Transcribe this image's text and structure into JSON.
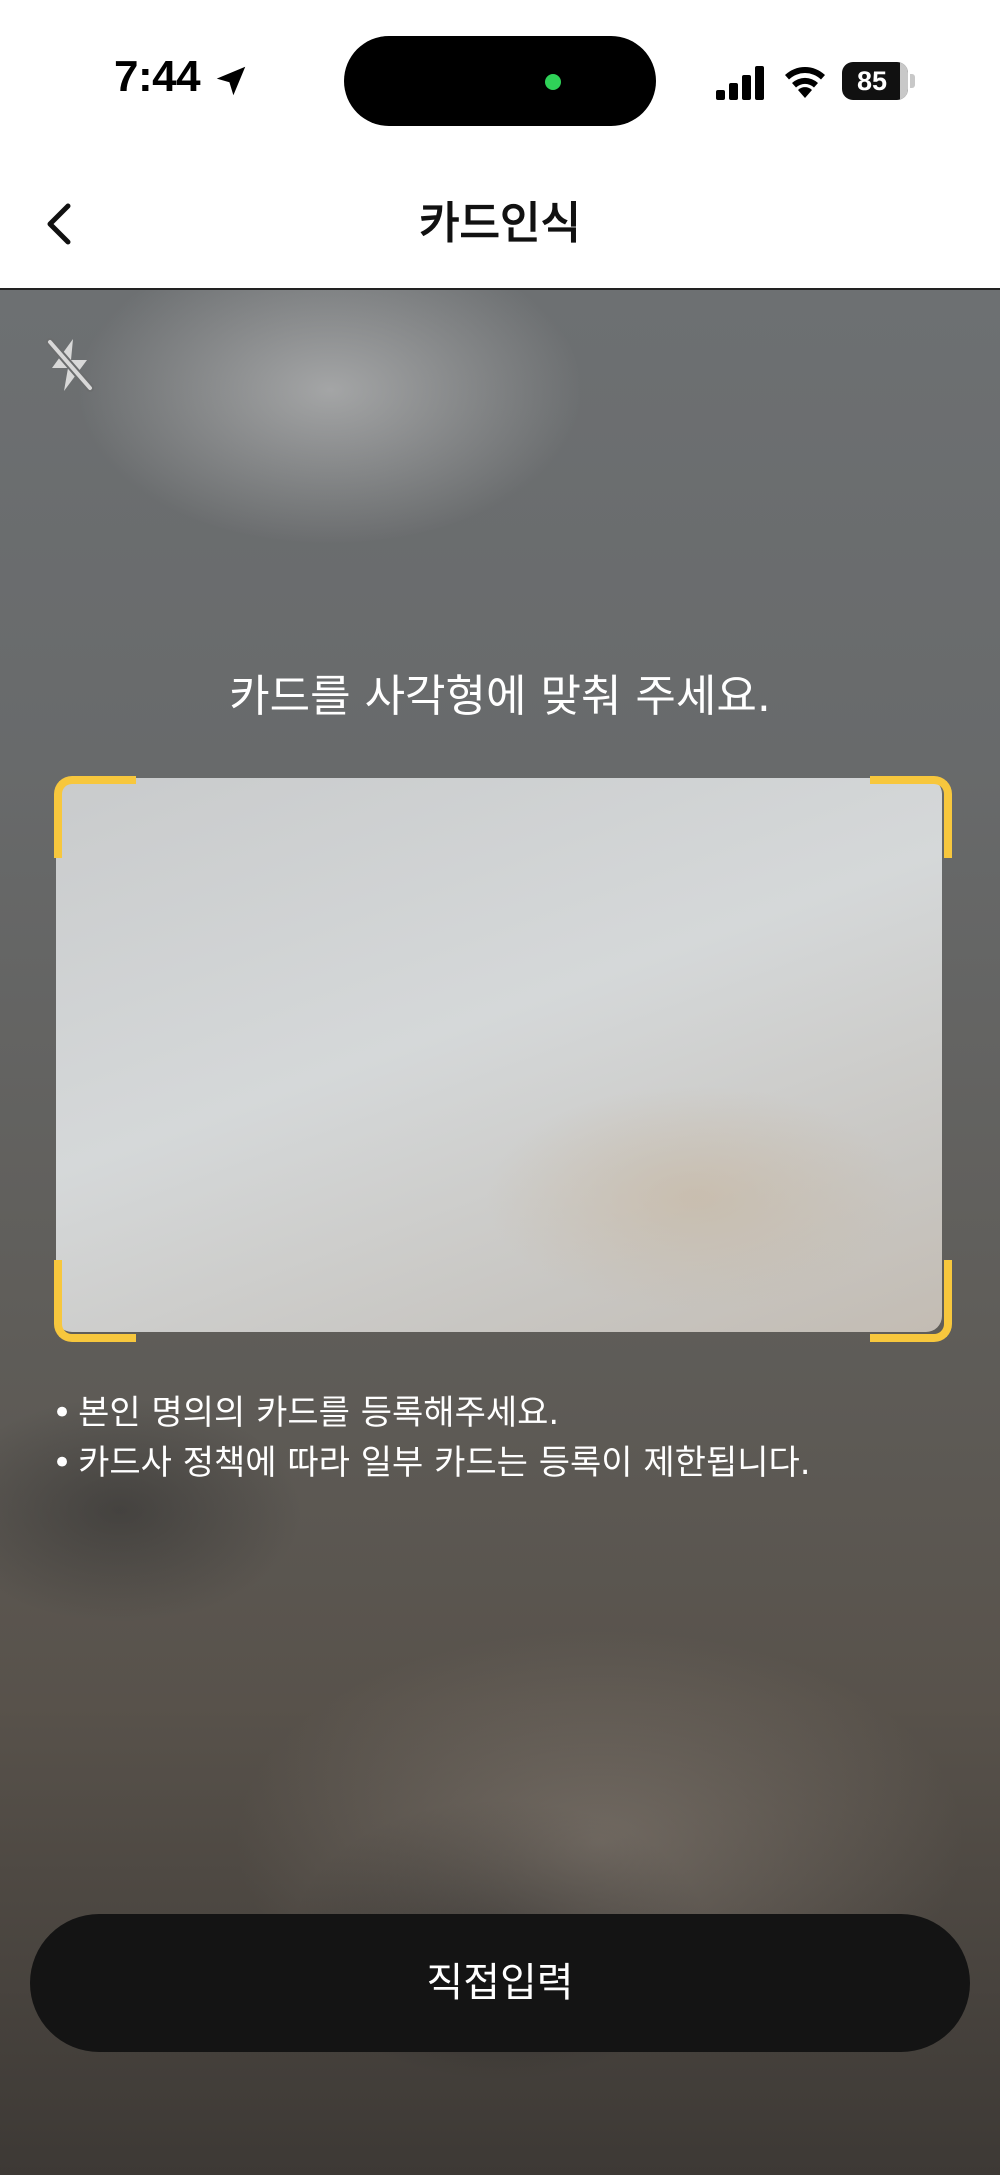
{
  "status_bar": {
    "time": "7:44",
    "battery_level": "85",
    "location_icon": "location-arrow-icon",
    "signal_icon": "cellular-signal-icon",
    "wifi_icon": "wifi-icon",
    "camera_indicator_color": "#2fd158"
  },
  "header": {
    "title": "카드인식",
    "back_icon": "chevron-left-icon"
  },
  "camera": {
    "flash_icon": "flash-off-icon",
    "instruction": "카드를 사각형에 맞춰 주세요.",
    "frame_corner_color": "#f7c73d",
    "notices": [
      "본인 명의의 카드를 등록해주세요.",
      "카드사 정책에 따라 일부 카드는 등록이 제한됩니다."
    ]
  },
  "actions": {
    "direct_input_label": "직접입력"
  }
}
